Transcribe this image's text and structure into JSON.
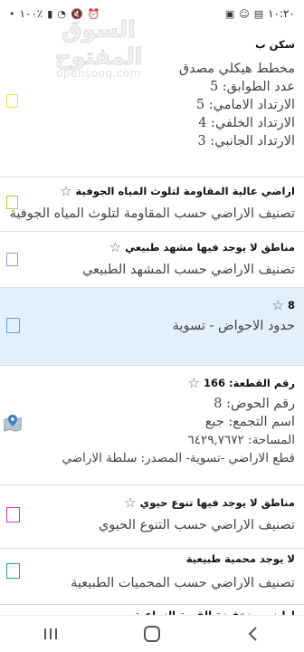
{
  "status_bar": {
    "time": "١٠:٢٠",
    "battery": "١٠٠٪",
    "icons": [
      "battery-icon",
      "wifi-icon",
      "mute-icon",
      "alarm-icon",
      "gallery-icon",
      "snapchat-icon",
      "messages-icon",
      "dot-icon"
    ]
  },
  "watermark": {
    "arabic": "السوق المفتوح",
    "latin": "opensooq.com"
  },
  "items": [
    {
      "title": "سكن ب",
      "lines": [
        "مخطط هيكلي مصدق",
        "عدد الطوابق: 5",
        "الارتداد الامامي: 5",
        "الارتداد الخلفي: 4",
        "الارتداد الجانبي: 3"
      ],
      "color": "#e6e34a",
      "selected": false
    },
    {
      "title": "اراضي عالية المقاومة لتلوث المياه الجوفية",
      "lines": [
        "تصنيف الاراضي حسب المقاومة لتلوث المياه الجوفية"
      ],
      "color": "#bcc24a",
      "selected": false
    },
    {
      "title": "مناطق لا يوجد فيها مشهد طبيعي",
      "lines": [
        "تصنيف الاراضي حسب المشهد الطبيعي"
      ],
      "color": "#8aa0d8",
      "selected": false
    },
    {
      "title": "8",
      "lines": [
        "حدود الاحواض - تسوية"
      ],
      "color": "#5ea2d6",
      "selected": true
    },
    {
      "title": "رقم القطعة: 166",
      "lines": [
        "رقم الحوض: 8",
        "اسم التجمع: جبع",
        "المساحة: ٦٤٢٩,٧٦٧٢",
        "قطع الاراضي -تسوية- المصدر: سلطة الاراضي"
      ],
      "color": "",
      "selected": false,
      "pin": true
    },
    {
      "title": "مناطق لا يوجد فيها تنوع حيوي",
      "lines": [
        "تصنيف الاراضي حسب التنوع الحيوي"
      ],
      "color": "#c83ac8",
      "selected": false
    },
    {
      "title": "لا يوجد محمية طبيعية",
      "lines": [
        "تصنيف الاراضي حسب المحميات الطبيعية"
      ],
      "color": "#2e9a9a",
      "selected": false
    },
    {
      "title": "اراضي منخفضة القيمة الزراعية",
      "lines": [],
      "color": "",
      "selected": false
    }
  ],
  "nav": {
    "buttons": [
      "recents-icon",
      "home-icon",
      "back-icon"
    ]
  }
}
